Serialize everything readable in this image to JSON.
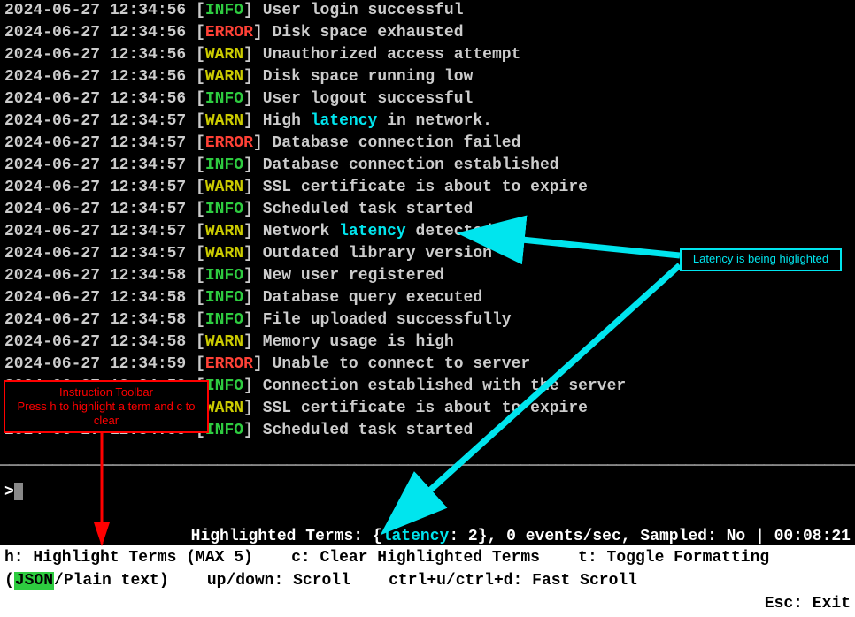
{
  "logs": [
    {
      "ts": "2024-06-27 12:34:56",
      "level": "INFO",
      "msg_pre": "User login successful",
      "hl": "",
      "msg_post": ""
    },
    {
      "ts": "2024-06-27 12:34:56",
      "level": "ERROR",
      "msg_pre": "Disk space exhausted",
      "hl": "",
      "msg_post": ""
    },
    {
      "ts": "2024-06-27 12:34:56",
      "level": "WARN",
      "msg_pre": "Unauthorized access attempt",
      "hl": "",
      "msg_post": ""
    },
    {
      "ts": "2024-06-27 12:34:56",
      "level": "WARN",
      "msg_pre": "Disk space running low",
      "hl": "",
      "msg_post": ""
    },
    {
      "ts": "2024-06-27 12:34:56",
      "level": "INFO",
      "msg_pre": "User logout successful",
      "hl": "",
      "msg_post": ""
    },
    {
      "ts": "2024-06-27 12:34:57",
      "level": "WARN",
      "msg_pre": "High ",
      "hl": "latency",
      "msg_post": " in network."
    },
    {
      "ts": "2024-06-27 12:34:57",
      "level": "ERROR",
      "msg_pre": "Database connection failed",
      "hl": "",
      "msg_post": ""
    },
    {
      "ts": "2024-06-27 12:34:57",
      "level": "INFO",
      "msg_pre": "Database connection established",
      "hl": "",
      "msg_post": ""
    },
    {
      "ts": "2024-06-27 12:34:57",
      "level": "WARN",
      "msg_pre": "SSL certificate is about to expire",
      "hl": "",
      "msg_post": ""
    },
    {
      "ts": "2024-06-27 12:34:57",
      "level": "INFO",
      "msg_pre": "Scheduled task started",
      "hl": "",
      "msg_post": ""
    },
    {
      "ts": "2024-06-27 12:34:57",
      "level": "WARN",
      "msg_pre": "Network ",
      "hl": "latency",
      "msg_post": " detected."
    },
    {
      "ts": "2024-06-27 12:34:57",
      "level": "WARN",
      "msg_pre": "Outdated library version",
      "hl": "",
      "msg_post": ""
    },
    {
      "ts": "2024-06-27 12:34:58",
      "level": "INFO",
      "msg_pre": "New user registered",
      "hl": "",
      "msg_post": ""
    },
    {
      "ts": "2024-06-27 12:34:58",
      "level": "INFO",
      "msg_pre": "Database query executed",
      "hl": "",
      "msg_post": ""
    },
    {
      "ts": "2024-06-27 12:34:58",
      "level": "INFO",
      "msg_pre": "File uploaded successfully",
      "hl": "",
      "msg_post": ""
    },
    {
      "ts": "2024-06-27 12:34:58",
      "level": "WARN",
      "msg_pre": "Memory usage is high",
      "hl": "",
      "msg_post": ""
    },
    {
      "ts": "2024-06-27 12:34:59",
      "level": "ERROR",
      "msg_pre": "Unable to connect to server",
      "hl": "",
      "msg_post": ""
    },
    {
      "ts": "2024-06-27 12:34:59",
      "level": "INFO",
      "msg_pre": "Connection established with the server",
      "hl": "",
      "msg_post": ""
    },
    {
      "ts": "2024-06-27 12:34:59",
      "level": "WARN",
      "msg_pre": "SSL certificate is about to expire",
      "hl": "",
      "msg_post": ""
    },
    {
      "ts": "2024-06-27 12:34:59",
      "level": "INFO",
      "msg_pre": "Scheduled task started",
      "hl": "",
      "msg_post": ""
    }
  ],
  "prompt": ">",
  "status": {
    "prefix": "Highlighted Terms: {",
    "term": "latency",
    "count": ": 2}, 0 events/sec, Sampled: No | 00:08:21"
  },
  "toolbar": {
    "h": "h: Highlight Terms (MAX 5)",
    "c": "c: Clear Highlighted Terms",
    "t": "t: Toggle Formatting",
    "fmt_open": " (",
    "json": "JSON",
    "fmt_rest": "/Plain text)",
    "scroll": "up/down: Scroll",
    "fast": "ctrl+u/ctrl+d: Fast Scroll",
    "exit": "Esc: Exit"
  },
  "callouts": {
    "red_line1": "Instruction Toolbar",
    "red_line2": "Press h to highlight a term and c to clear",
    "cyan": "Latency is being higlighted"
  },
  "level_colors": {
    "INFO": "lvl-info",
    "WARN": "lvl-warn",
    "ERROR": "lvl-error"
  }
}
